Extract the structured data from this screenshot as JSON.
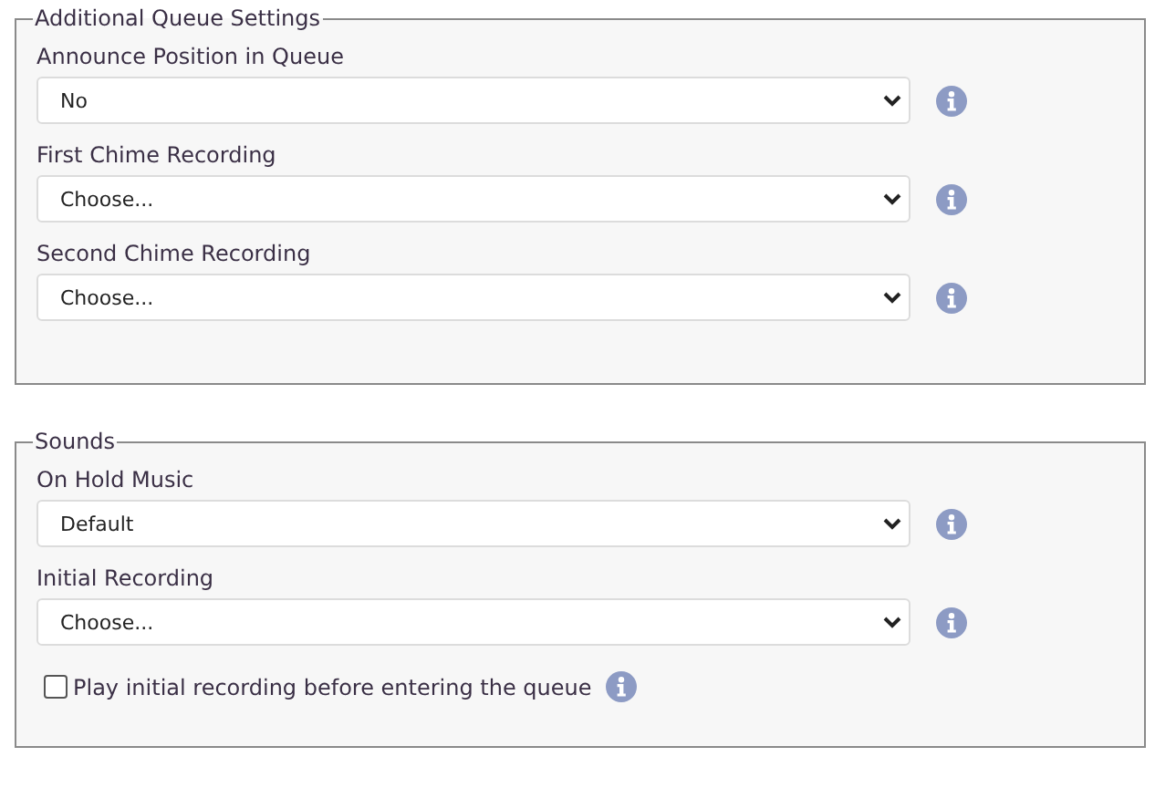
{
  "sections": [
    {
      "title": "Additional Queue Settings",
      "rows": [
        {
          "kind": "select",
          "label": "Announce Position in Queue",
          "value": "No"
        },
        {
          "kind": "select",
          "label": "First Chime Recording",
          "value": "Choose..."
        },
        {
          "kind": "select",
          "label": "Second Chime Recording",
          "value": "Choose..."
        }
      ]
    },
    {
      "title": "Sounds",
      "rows": [
        {
          "kind": "select",
          "label": "On Hold Music",
          "value": "Default"
        },
        {
          "kind": "select",
          "label": "Initial Recording",
          "value": "Choose..."
        },
        {
          "kind": "checkbox",
          "label": "Play initial recording before entering the queue",
          "checked": false
        }
      ]
    }
  ]
}
